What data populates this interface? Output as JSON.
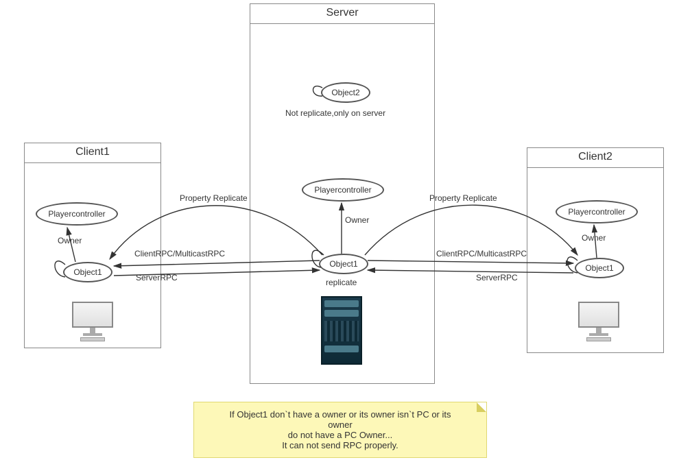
{
  "server": {
    "title": "Server",
    "object2": "Object2",
    "not_replicate": "Not replicate,only on server",
    "playercontroller": "Playercontroller",
    "owner": "Owner",
    "object1": "Object1",
    "replicate": "replicate"
  },
  "client1": {
    "title": "Client1",
    "playercontroller": "Playercontroller",
    "owner": "Owner",
    "object1": "Object1"
  },
  "client2": {
    "title": "Client2",
    "playercontroller": "Playercontroller",
    "owner": "Owner",
    "object1": "Object1"
  },
  "labels": {
    "prop_rep_left": "Property Replicate",
    "prop_rep_right": "Property Replicate",
    "clientrpc_left": "ClientRPC/MulticastRPC",
    "serverrpc_left": "ServerRPC",
    "clientrpc_right": "ClientRPC/MulticastRPC",
    "serverrpc_right": "ServerRPC"
  },
  "note": {
    "line1": "If Object1 don`t have a owner or its owner isn`t PC or its owner",
    "line2": "do not have a PC Owner...",
    "line3": "It can not send RPC properly."
  }
}
